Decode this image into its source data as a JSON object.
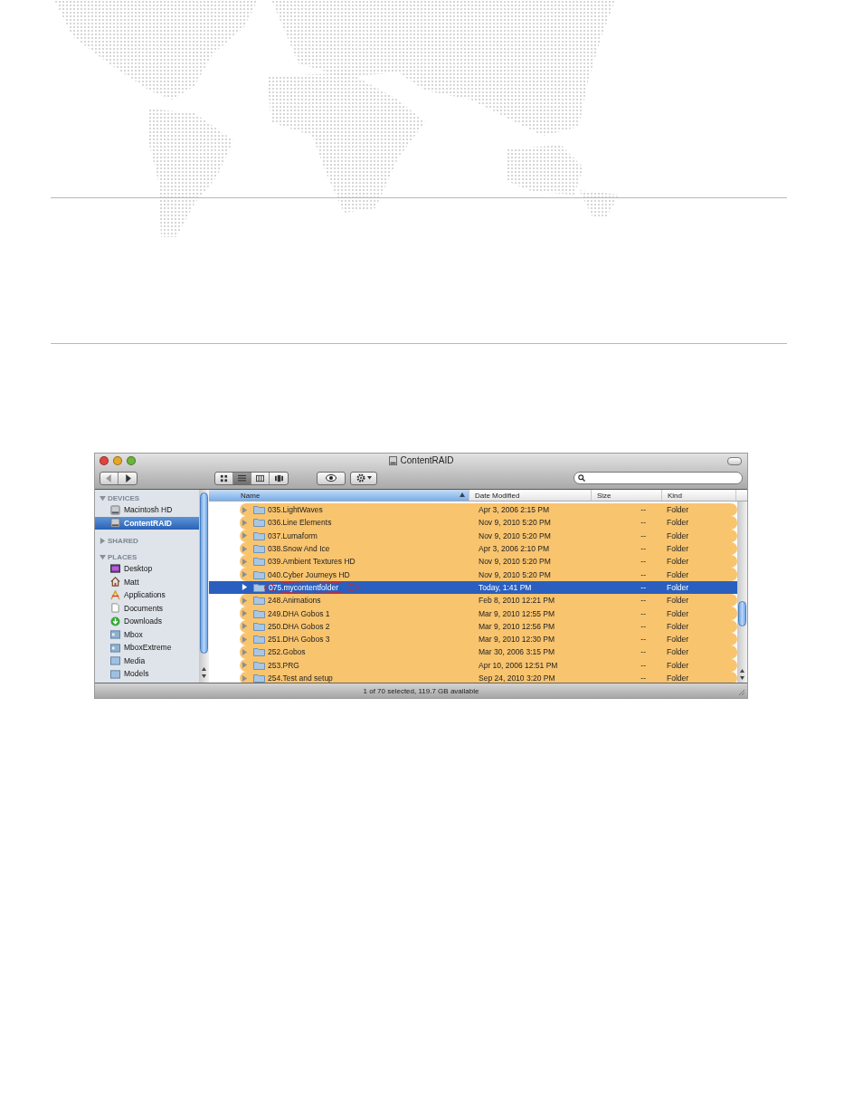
{
  "window": {
    "title": "ContentRAID"
  },
  "toolbar": {
    "view_buttons": [
      {
        "kind": "icon",
        "selected": false
      },
      {
        "kind": "list",
        "selected": true
      },
      {
        "kind": "column",
        "selected": false
      },
      {
        "kind": "coverflow",
        "selected": false
      }
    ]
  },
  "sidebar": {
    "sections": [
      {
        "title": "DEVICES",
        "expanded": true,
        "items": [
          {
            "kind": "disk",
            "label": "Macintosh HD",
            "selected": false
          },
          {
            "kind": "disk",
            "label": "ContentRAID",
            "selected": true
          }
        ]
      },
      {
        "title": "SHARED",
        "expanded": false
      },
      {
        "title": "PLACES",
        "expanded": true,
        "items": [
          {
            "kind": "desktop",
            "label": "Desktop",
            "selected": false
          },
          {
            "kind": "home",
            "label": "Matt",
            "selected": false
          },
          {
            "kind": "apps",
            "label": "Applications",
            "selected": false
          },
          {
            "kind": "document",
            "label": "Documents",
            "selected": false
          },
          {
            "kind": "download",
            "label": "Downloads",
            "selected": false
          },
          {
            "kind": "volume",
            "label": "Mbox",
            "selected": false
          },
          {
            "kind": "volume",
            "label": "MboxExtreme",
            "selected": false
          },
          {
            "kind": "folder",
            "label": "Media",
            "selected": false
          },
          {
            "kind": "folder",
            "label": "Models",
            "selected": false
          }
        ]
      }
    ]
  },
  "table": {
    "columns": [
      {
        "label": "Name",
        "sorted": true
      },
      {
        "label": "Date Modified",
        "sorted": false
      },
      {
        "label": "Size",
        "sorted": false
      },
      {
        "label": "Kind",
        "sorted": false
      }
    ],
    "rows": [
      {
        "name": "035.LightWaves",
        "date": "Apr 3, 2006 2:15 PM",
        "size": "--",
        "kind": "Folder",
        "selected": false,
        "circled": false,
        "color": "#f9c46e"
      },
      {
        "name": "036.Line Elements",
        "date": "Nov 9, 2010 5:20 PM",
        "size": "--",
        "kind": "Folder",
        "selected": false,
        "circled": false,
        "color": "#f9c46e"
      },
      {
        "name": "037.Lumaform",
        "date": "Nov 9, 2010 5:20 PM",
        "size": "--",
        "kind": "Folder",
        "selected": false,
        "circled": false,
        "color": "#f9c46e"
      },
      {
        "name": "038.Snow And Ice",
        "date": "Apr 3, 2006 2:10 PM",
        "size": "--",
        "kind": "Folder",
        "selected": false,
        "circled": false,
        "color": "#f9c46e"
      },
      {
        "name": "039.Ambient Textures HD",
        "date": "Nov 9, 2010 5:20 PM",
        "size": "--",
        "kind": "Folder",
        "selected": false,
        "circled": false,
        "color": "#f9c46e"
      },
      {
        "name": "040.Cyber Journeys HD",
        "date": "Nov 9, 2010 5:20 PM",
        "size": "--",
        "kind": "Folder",
        "selected": false,
        "circled": false,
        "color": "#f9c46e"
      },
      {
        "name": "075.mycontentfolder",
        "date": "Today, 1:41 PM",
        "size": "--",
        "kind": "Folder",
        "selected": true,
        "circled": true
      },
      {
        "name": "248.Animations",
        "date": "Feb 8, 2010 12:21 PM",
        "size": "--",
        "kind": "Folder",
        "selected": false,
        "circled": false,
        "color": "#f9c46e"
      },
      {
        "name": "249.DHA Gobos 1",
        "date": "Mar 9, 2010 12:55 PM",
        "size": "--",
        "kind": "Folder",
        "selected": false,
        "circled": false,
        "color": "#f9c46e"
      },
      {
        "name": "250.DHA Gobos 2",
        "date": "Mar 9, 2010 12:56 PM",
        "size": "--",
        "kind": "Folder",
        "selected": false,
        "circled": false,
        "color": "#f9c46e"
      },
      {
        "name": "251.DHA Gobos 3",
        "date": "Mar 9, 2010 12:30 PM",
        "size": "--",
        "kind": "Folder",
        "selected": false,
        "circled": false,
        "color": "#f9c46e"
      },
      {
        "name": "252.Gobos",
        "date": "Mar 30, 2006 3:15 PM",
        "size": "--",
        "kind": "Folder",
        "selected": false,
        "circled": false,
        "color": "#f9c46e"
      },
      {
        "name": "253.PRG",
        "date": "Apr 10, 2006 12:51 PM",
        "size": "--",
        "kind": "Folder",
        "selected": false,
        "circled": false,
        "color": "#f9c46e"
      },
      {
        "name": "254.Test and setup",
        "date": "Sep 24, 2010 3:20 PM",
        "size": "--",
        "kind": "Folder",
        "selected": false,
        "circled": false,
        "color": "#f9c46e"
      }
    ]
  },
  "status_bar": "1 of 70 selected, 119.7 GB available"
}
